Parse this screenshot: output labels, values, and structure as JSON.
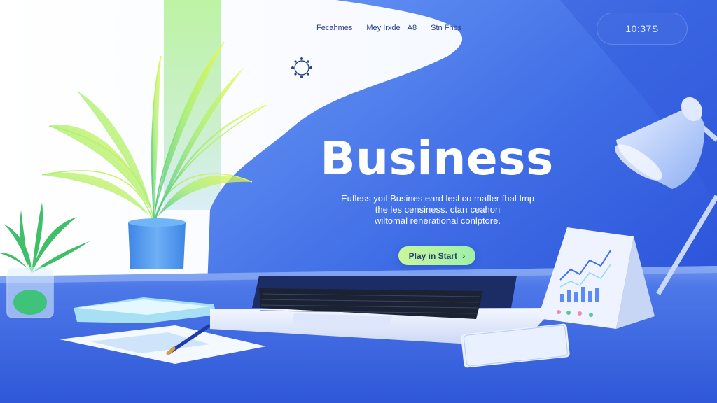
{
  "nav": {
    "items": [
      "Fecahmes",
      "Mey Irxde",
      "A8",
      "Stn Fhbs"
    ]
  },
  "clock": "10:37S",
  "hero": {
    "title": "Business",
    "subtitle_lines": [
      "Eufless yoıl Busines eard lesl co mafler fhal Imp",
      "the les censiness. ctarı ceahon",
      "wiltomal renerational conlptore."
    ],
    "cta_label": "Play in Start",
    "cta_icon": "chevron-right-icon"
  },
  "colors": {
    "primary_blue": "#2f5fe0",
    "light_blue": "#5d8ff0",
    "accent_green": "#b8f59e",
    "white": "#ffffff"
  }
}
